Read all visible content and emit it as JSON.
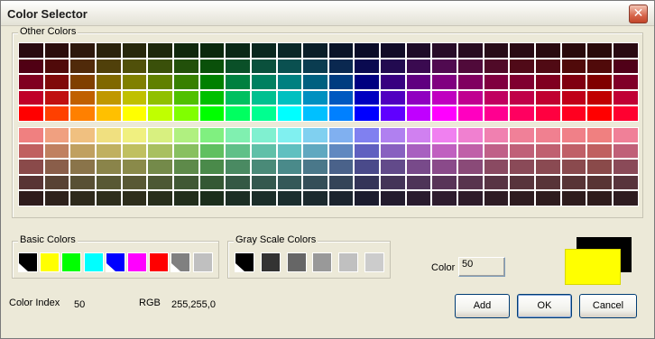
{
  "window": {
    "title": "Color Selector",
    "close_glyph": "✕"
  },
  "other_colors": {
    "label": "Other Colors",
    "top_rows": [
      [
        "#2a0a10",
        "#2b0d0c",
        "#2d180c",
        "#2b230c",
        "#28280c",
        "#1e280c",
        "#10280c",
        "#0a280c",
        "#0a2816",
        "#0a281f",
        "#0a2828",
        "#0a1e28",
        "#0a1428",
        "#0a0c28",
        "#120c28",
        "#1e0c28",
        "#280c28",
        "#280c20",
        "#280c18",
        "#2a0a14",
        "#2a0a10",
        "#2a0a0c",
        "#2a0a0a",
        "#2a0a12"
      ],
      [
        "#500014",
        "#500a0a",
        "#502a0a",
        "#50400a",
        "#50500a",
        "#3a500a",
        "#22500a",
        "#0a500a",
        "#0a5028",
        "#0a503c",
        "#0a5050",
        "#0a3c50",
        "#0a2850",
        "#0a0a50",
        "#220a50",
        "#3a0a50",
        "#500a50",
        "#500a3a",
        "#500a28",
        "#500a18",
        "#500a14",
        "#500a0a",
        "#500a0a",
        "#500018"
      ],
      [
        "#800020",
        "#800a0a",
        "#804000",
        "#806800",
        "#808000",
        "#608000",
        "#388000",
        "#008000",
        "#008040",
        "#008060",
        "#008080",
        "#006080",
        "#003c80",
        "#000080",
        "#380080",
        "#600080",
        "#800080",
        "#800060",
        "#800040",
        "#800030",
        "#800020",
        "#800010",
        "#800000",
        "#800028"
      ],
      [
        "#c00028",
        "#c01010",
        "#c06000",
        "#c09800",
        "#c0c000",
        "#90c000",
        "#50c000",
        "#00c000",
        "#00c060",
        "#00c090",
        "#00c0c0",
        "#0090c0",
        "#0058c0",
        "#0000c0",
        "#5000c0",
        "#9000c0",
        "#c000c0",
        "#c00090",
        "#c00060",
        "#c00048",
        "#c00030",
        "#c00018",
        "#c00000",
        "#c00034"
      ],
      [
        "#ff0000",
        "#ff4000",
        "#ff8000",
        "#ffc000",
        "#ffff00",
        "#c0ff00",
        "#80ff00",
        "#00ff00",
        "#00ff60",
        "#00ff90",
        "#00ffff",
        "#00c0ff",
        "#0080ff",
        "#0000ff",
        "#6000ff",
        "#c000ff",
        "#ff00ff",
        "#ff00c0",
        "#ff0090",
        "#ff0060",
        "#ff0040",
        "#ff0020",
        "#ff0000",
        "#ff0030"
      ]
    ],
    "bottom_rows": [
      [
        "#f08080",
        "#f0a080",
        "#f0c080",
        "#f0e080",
        "#f0f080",
        "#d8f080",
        "#b0f080",
        "#80f080",
        "#80f0b0",
        "#80f0d0",
        "#80f0f0",
        "#80d0f0",
        "#80b0f0",
        "#8080f0",
        "#b080f0",
        "#d080f0",
        "#f080f0",
        "#f080d0",
        "#f080b0",
        "#f08098",
        "#f08090",
        "#f08088",
        "#f08080",
        "#f08098"
      ],
      [
        "#c06060",
        "#c08060",
        "#c0a060",
        "#c0b060",
        "#c0c060",
        "#a8c060",
        "#88c060",
        "#60c060",
        "#60c088",
        "#60c0a8",
        "#60c0c0",
        "#60a8c0",
        "#6088c0",
        "#6060c0",
        "#8860c0",
        "#a860c0",
        "#c060c0",
        "#c060a8",
        "#c06088",
        "#c06078",
        "#c06070",
        "#c06068",
        "#c06060",
        "#c06078"
      ],
      [
        "#8a4a4a",
        "#8a5e4a",
        "#8a744a",
        "#8a844a",
        "#8a8a4a",
        "#748a4a",
        "#5e8a4a",
        "#4a8a4a",
        "#4a8a62",
        "#4a8a78",
        "#4a8a8a",
        "#4a788a",
        "#4a628a",
        "#4a4a8a",
        "#624a8a",
        "#784a8a",
        "#8a4a8a",
        "#8a4a78",
        "#8a4a62",
        "#8a4a58",
        "#8a4a52",
        "#8a4a4e",
        "#8a4a4a",
        "#8a4a58"
      ],
      [
        "#583434",
        "#584234",
        "#585034",
        "#585834",
        "#585834",
        "#4c5834",
        "#405834",
        "#345834",
        "#345844",
        "#34584e",
        "#345858",
        "#344e58",
        "#344458",
        "#343458",
        "#443458",
        "#4e3458",
        "#583458",
        "#58344e",
        "#583444",
        "#58343c",
        "#583438",
        "#583436",
        "#583434",
        "#58343c"
      ],
      [
        "#2e1c1c",
        "#2e221c",
        "#2e2a1c",
        "#2e2e1c",
        "#2e2e1c",
        "#282e1c",
        "#222e1c",
        "#1c2e1c",
        "#1c2e24",
        "#1c2e2a",
        "#1c2e2e",
        "#1c2a2e",
        "#1c242e",
        "#1c1c2e",
        "#241c2e",
        "#2a1c2e",
        "#2e1c2e",
        "#2e1c2a",
        "#2e1c24",
        "#2e1c20",
        "#2e1c1e",
        "#2e1c1d",
        "#2e1c1c",
        "#2e1c20"
      ]
    ]
  },
  "basic_colors": {
    "label": "Basic Colors",
    "swatches": [
      "#000000",
      "#ffff00",
      "#00ff00",
      "#00ffff",
      "#0000ff",
      "#ff00ff",
      "#ff0000",
      "#808080",
      "#c0c0c0"
    ],
    "selected_index": 1
  },
  "gray_scale": {
    "label": "Gray Scale Colors",
    "swatches": [
      "#000000",
      "#333333",
      "#666666",
      "#999999",
      "#c0c0c0",
      "#cccccc"
    ]
  },
  "color_field": {
    "label": "Color",
    "value": "50"
  },
  "color_index": {
    "label": "Color Index",
    "value": "50"
  },
  "rgb": {
    "label": "RGB",
    "value": "255,255,0"
  },
  "preview": {
    "old_color": "#000000",
    "new_color": "#FFFF00"
  },
  "buttons": {
    "add": "Add",
    "ok": "OK",
    "cancel": "Cancel"
  }
}
